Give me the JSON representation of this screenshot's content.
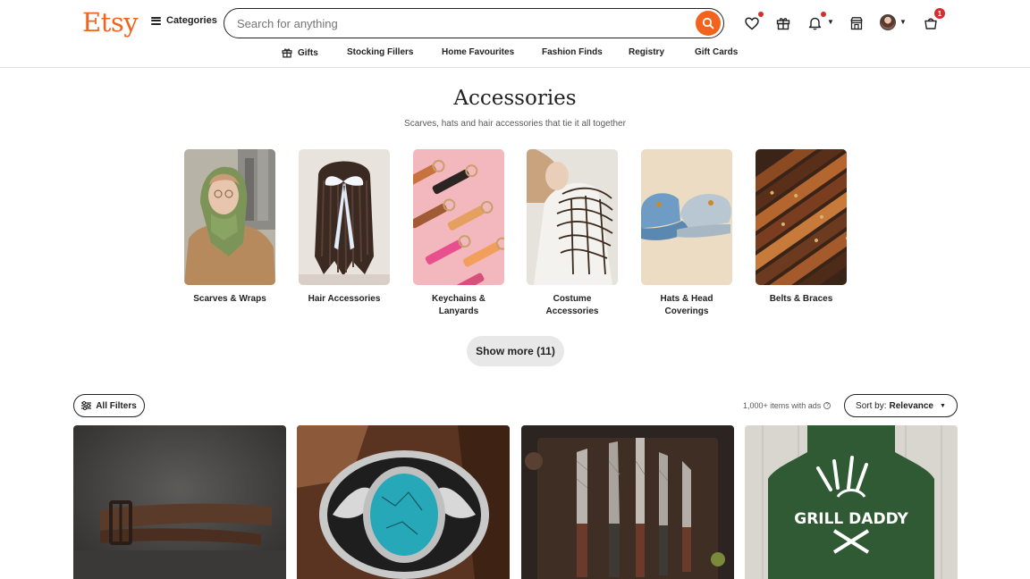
{
  "header": {
    "logo": "Etsy",
    "categories_label": "Categories",
    "search_placeholder": "Search for anything",
    "cart_count": "1",
    "accent_color": "#f1641e"
  },
  "subnav": {
    "items": [
      {
        "label": "Gifts",
        "icon": "gift-icon"
      },
      {
        "label": "Stocking Fillers"
      },
      {
        "label": "Home Favourites"
      },
      {
        "label": "Fashion Finds"
      },
      {
        "label": "Registry"
      },
      {
        "label": "Gift Cards"
      }
    ]
  },
  "hero": {
    "title": "Accessories",
    "subtitle": "Scarves, hats and hair accessories that tie it all together"
  },
  "categories": [
    {
      "label": "Scarves & Wraps"
    },
    {
      "label": "Hair Accessories"
    },
    {
      "label": "Keychains & Lanyards"
    },
    {
      "label": "Costume Accessories"
    },
    {
      "label": "Hats & Head Coverings"
    },
    {
      "label": "Belts & Braces"
    }
  ],
  "show_more_label": "Show more (11)",
  "toolbar": {
    "filters_label": "All Filters",
    "results_count": "1,000+ items with ads",
    "sort_prefix": "Sort by:",
    "sort_value": "Relevance"
  },
  "products": [
    {
      "icon": "leather-belt-image"
    },
    {
      "icon": "turquoise-buckle-image"
    },
    {
      "icon": "damascus-knives-image"
    },
    {
      "icon": "grill-daddy-apron-image",
      "text": "GRILL DADDY"
    }
  ]
}
